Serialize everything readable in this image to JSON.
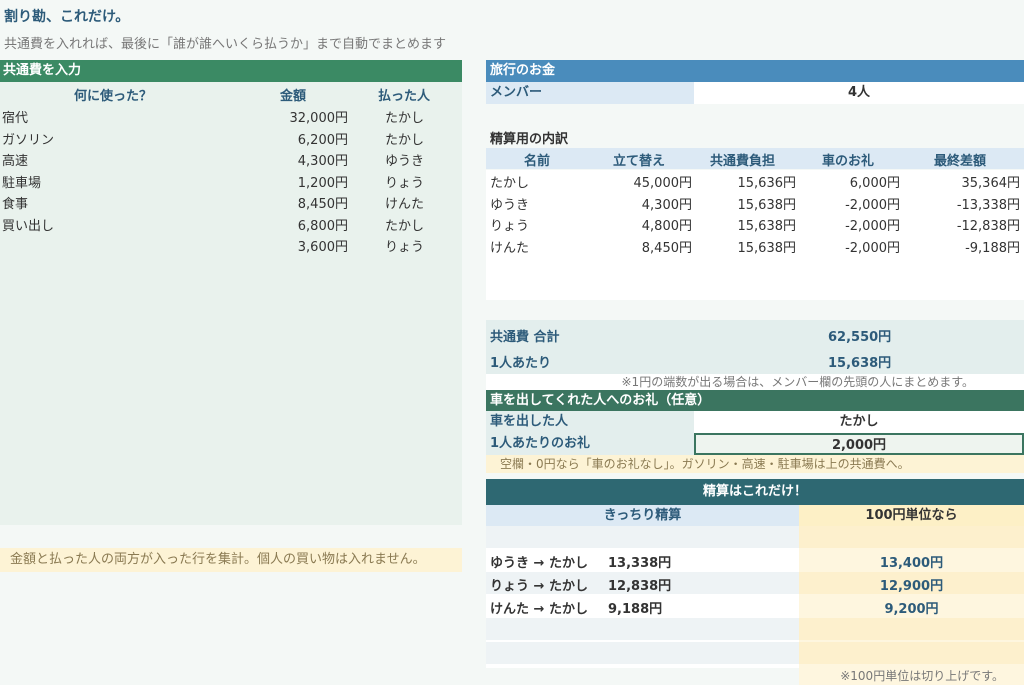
{
  "header": {
    "title": "割り勘、これだけ。",
    "subtitle": "共通費を入れれば、最後に「誰が誰へいくら払うか」まで自動でまとめます"
  },
  "expenses": {
    "section_title": "共通費を入力",
    "columns": [
      "何に使った？",
      "金額",
      "払った人"
    ],
    "rows": [
      {
        "item": "宿代",
        "amount": "32,000円",
        "payer": "たかし"
      },
      {
        "item": "ガソリン",
        "amount": "6,200円",
        "payer": "たかし"
      },
      {
        "item": "高速",
        "amount": "4,300円",
        "payer": "ゆうき"
      },
      {
        "item": "駐車場",
        "amount": "1,200円",
        "payer": "りょう"
      },
      {
        "item": "食事",
        "amount": "8,450円",
        "payer": "けんた"
      },
      {
        "item": "買い出し",
        "amount": "6,800円",
        "payer": "たかし"
      },
      {
        "item": "",
        "amount": "3,600円",
        "payer": "りょう"
      }
    ],
    "hint": "金額と払った人の両方が入った行を集計。個人の買い物は入れません。"
  },
  "trip": {
    "section_title": "旅行のお金",
    "member_label": "メンバー",
    "member_count": "4人"
  },
  "breakdown": {
    "title": "精算用の内訳",
    "columns": [
      "名前",
      "立て替え",
      "共通費負担",
      "車のお礼",
      "最終差額"
    ],
    "rows": [
      {
        "name": "たかし",
        "paid": "45,000円",
        "share": "15,636円",
        "car": "6,000円",
        "diff": "35,364円"
      },
      {
        "name": "ゆうき",
        "paid": "4,300円",
        "share": "15,638円",
        "car": "-2,000円",
        "diff": "-13,338円"
      },
      {
        "name": "りょう",
        "paid": "4,800円",
        "share": "15,638円",
        "car": "-2,000円",
        "diff": "-12,838円"
      },
      {
        "name": "けんた",
        "paid": "8,450円",
        "share": "15,638円",
        "car": "-2,000円",
        "diff": "-9,188円"
      }
    ]
  },
  "summary": {
    "total_label": "共通費 合計",
    "total_value": "62,550円",
    "per_person_label": "1人あたり",
    "per_person_value": "15,638円",
    "note": "※1円の端数が出る場合は、メンバー欄の先頭の人にまとめます。"
  },
  "car": {
    "section_title": "車を出してくれた人へのお礼（任意）",
    "driver_label": "車を出した人",
    "driver_value": "たかし",
    "thanks_label": "1人あたりのお礼",
    "thanks_value": "2,000円",
    "note": "空欄・0円なら「車のお礼なし」。ガソリン・高速・駐車場は上の共通費へ。"
  },
  "settlement": {
    "section_title": "精算はこれだけ！",
    "exact_header": "きっちり精算",
    "rounded_header": "100円単位なら",
    "rows": [
      {
        "who": "ゆうき → たかし",
        "exact": "13,338円",
        "rounded": "13,400円"
      },
      {
        "who": "りょう → たかし",
        "exact": "12,838円",
        "rounded": "12,900円"
      },
      {
        "who": "けんた → たかし",
        "exact": "9,188円",
        "rounded": "9,200円"
      }
    ],
    "note": "※100円単位は切り上げです。"
  }
}
